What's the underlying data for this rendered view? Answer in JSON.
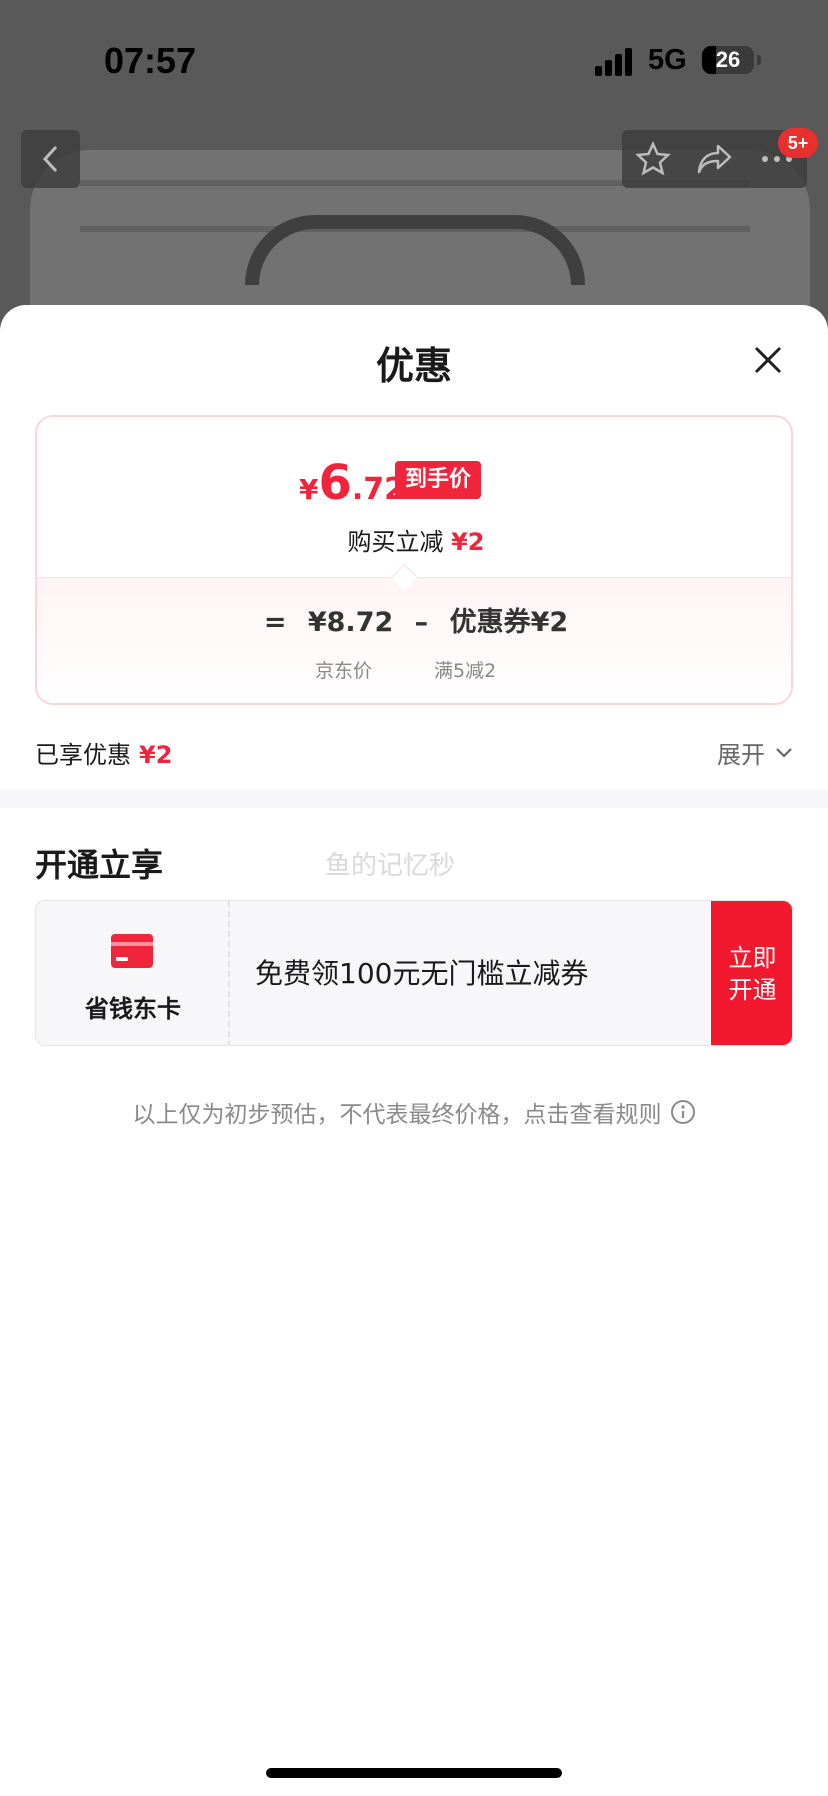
{
  "status": {
    "time": "07:57",
    "network": "5G",
    "battery": "26",
    "battery_level": 0.26
  },
  "topbar": {
    "badge": "5+"
  },
  "sheet": {
    "title": "优惠",
    "price": {
      "currency": "¥",
      "integer": "6",
      "decimal": ".72",
      "tag": "到手价",
      "instant_label": "购买立减",
      "instant_value": "¥2",
      "equals": "=",
      "base_price": "¥8.72",
      "minus": "–",
      "coupon_label": "优惠券",
      "coupon_value": "¥2",
      "base_caption": "京东价",
      "coupon_caption": "满5减2"
    },
    "enjoyed": {
      "label": "已享优惠",
      "value": "¥2",
      "expand": "展开"
    },
    "open_section": {
      "title": "开通立享",
      "watermark": "鱼的记忆秒",
      "card_name": "省钱东卡",
      "card_desc": "免费领100元无门槛立减券",
      "button_line1": "立即",
      "button_line2": "开通"
    },
    "disclaimer": "以上仅为初步预估，不代表最终价格，点击查看规则"
  },
  "colors": {
    "accent": "#f0243a",
    "button": "#f2192f"
  },
  "icons": [
    "back-icon",
    "star-icon",
    "share-icon",
    "more-icon",
    "close-icon",
    "chevron-down-icon",
    "card-icon",
    "info-icon"
  ]
}
